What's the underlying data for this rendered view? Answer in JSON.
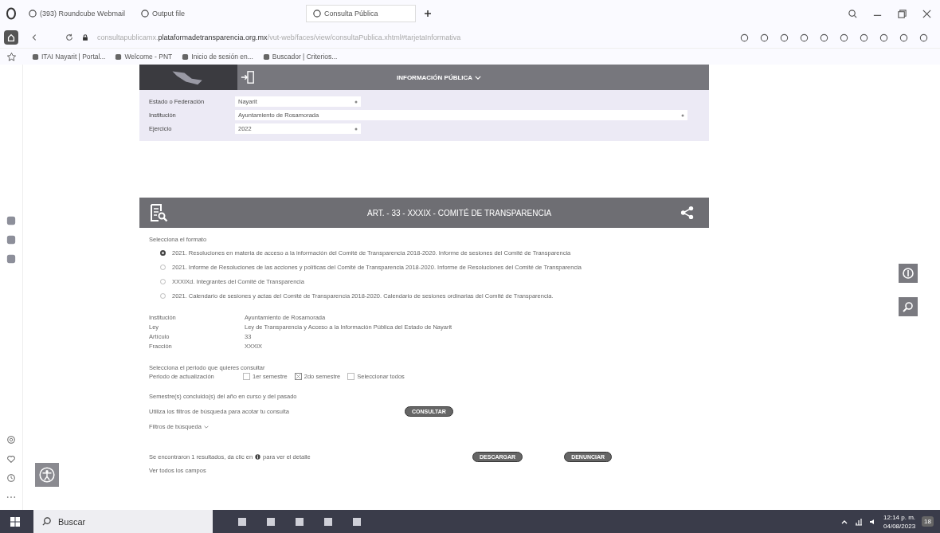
{
  "browser": {
    "tabs": [
      {
        "label": "(393) Roundcube Webmail",
        "selected": false
      },
      {
        "label": "Output file",
        "selected": false
      },
      {
        "label": "Consulta Pública",
        "selected": true
      }
    ],
    "address": {
      "prefix": "consultapublicamx.",
      "domain": "plataformadetransparencia.org.mx",
      "path": "/vut-web/faces/view/consultaPublica.xhtml#tarjetaInformativa"
    },
    "bookmarks": [
      "ITAI Nayarit | Portal...",
      "Welcome - PNT",
      "Inicio de sesión en...",
      "Buscador | Criterios..."
    ]
  },
  "page": {
    "menu_label": "INFORMACIÓN PÚBLICA",
    "filters": [
      {
        "label": "Estado o Federación",
        "value": "Nayarit",
        "kind": "select"
      },
      {
        "label": "Institución",
        "value": "Ayuntamiento de Rosamorada",
        "kind": "select"
      },
      {
        "label": "Ejercicio",
        "value": "2022",
        "kind": "select"
      }
    ],
    "section_title": "ART. - 33 - XXXIX - COMITÉ DE TRANSPARENCIA",
    "format_prompt": "Selecciona el formato",
    "formats": [
      {
        "label": "2021. Resoluciones en materia de acceso a la información del Comité de Transparencia 2018-2020. Informe de sesiones del Comité de Transparencia",
        "selected": true
      },
      {
        "label": "2021. Informe de Resoluciones de las acciones y políticas del Comité de Transparencia 2018-2020. Informe de Resoluciones del Comité de Transparencia",
        "selected": false
      },
      {
        "label": "XXXIXd. Integrantes del Comité de Transparencia",
        "selected": false
      },
      {
        "label": "2021. Calendario de sesiones y actas del Comité de Transparencia 2018-2020. Calendario de sesiones ordinarias del Comité de Transparencia.",
        "selected": false
      }
    ],
    "details": [
      {
        "label": "Institución",
        "value": "Ayuntamiento de Rosamorada"
      },
      {
        "label": "Ley",
        "value": "Ley de Transparencia y Acceso a la Información Pública del Estado de Nayarit"
      },
      {
        "label": "Artículo",
        "value": "33"
      },
      {
        "label": "Fracción",
        "value": "XXXIX"
      }
    ],
    "period": {
      "prompt": "Selecciona el periodo que quieres consultar",
      "label": "Periodo de actualización",
      "options": [
        {
          "label": "1er semestre",
          "checked": false
        },
        {
          "label": "2do semestre",
          "checked": true
        },
        {
          "label": "Seleccionar todos",
          "checked": false
        }
      ]
    },
    "note": "Semestre(s) concluido(s) del año en curso y del pasado",
    "filter_hint": "Utiliza los filtros de búsqueda para acotar tu consulta",
    "consult_button": "CONSULTAR",
    "filters_toggle": "Filtros de búsqueda",
    "results_before": "Se encontraron 1 resultados, da clic en",
    "results_after": "para ver el detalle",
    "download_button": "DESCARGAR",
    "report_button": "DENUNCIAR",
    "view_all": "Ver todos los campos"
  },
  "taskbar": {
    "search_placeholder": "Buscar",
    "time": "12:14 p. m.",
    "date": "04/08/2023",
    "notifications": "18"
  }
}
